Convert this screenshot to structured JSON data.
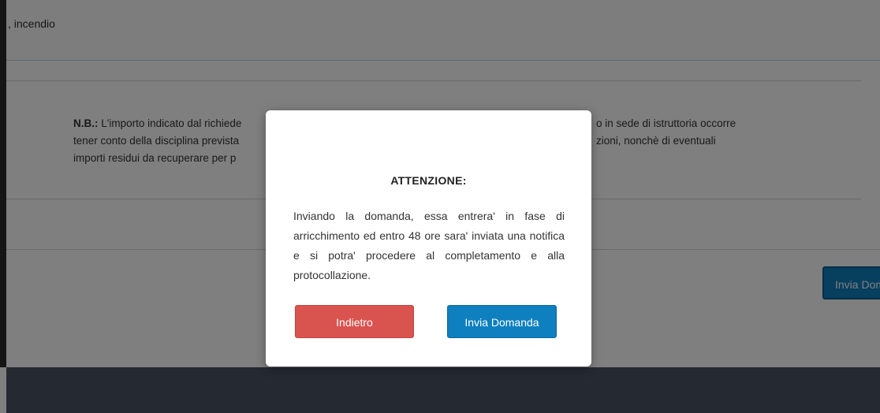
{
  "background": {
    "field_value": ", incendio",
    "note": {
      "label": "N.B.:",
      "line1_left": " L'importo indicato dal richiede",
      "line2_left": "tener conto della disciplina prevista",
      "line3_left": "importi residui da recuperare per p",
      "line1_right": "o in sede di istruttoria occorre",
      "line2_right": "zioni, nonchè di eventuali"
    },
    "submit_label": "Invia Domanda"
  },
  "modal": {
    "title": "ATTENZIONE:",
    "message": "Inviando la domanda, essa entrera' in fase di arricchimento ed entro 48 ore sara' inviata una notifica e si potra' procedere al completamento e alla protocollazione.",
    "back_label": "Indietro",
    "confirm_label": "Invia Domanda"
  },
  "colors": {
    "danger": "#d9534f",
    "primary": "#0e7fbf",
    "footer": "#4a5565",
    "overlay": "rgba(0,0,0,0.5)"
  }
}
